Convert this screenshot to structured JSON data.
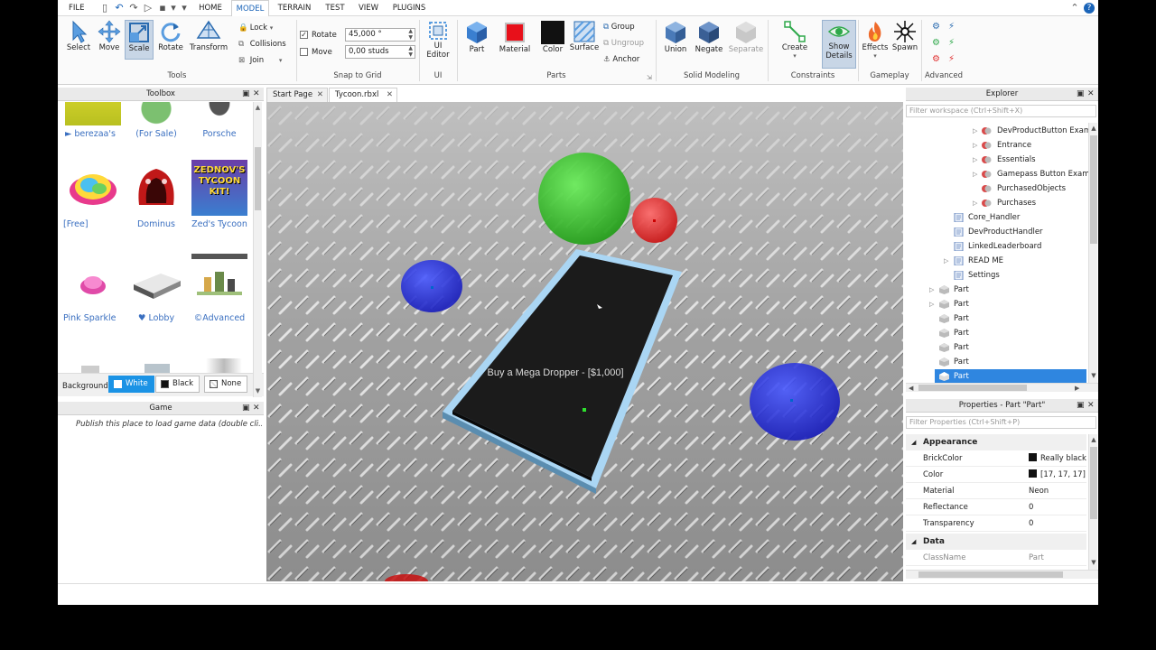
{
  "menubar": {
    "file": "FILE",
    "tabs": [
      "HOME",
      "MODEL",
      "TERRAIN",
      "TEST",
      "VIEW",
      "PLUGINS"
    ],
    "active_tab": "MODEL"
  },
  "ribbon": {
    "tools": {
      "buttons": [
        "Select",
        "Move",
        "Scale",
        "Rotate",
        "Transform"
      ],
      "active": "Scale",
      "lock": "Lock",
      "collisions": "Collisions",
      "join": "Join",
      "label": "Tools"
    },
    "snap": {
      "rotate_label": "Rotate",
      "rotate_value": "45,000 °",
      "move_label": "Move",
      "move_value": "0,00 studs",
      "label": "Snap to Grid"
    },
    "ui": {
      "button": "UI Editor",
      "label": "UI"
    },
    "parts": {
      "buttons": [
        "Part",
        "Material",
        "Color",
        "Surface"
      ],
      "group": "Group",
      "ungroup": "Ungroup",
      "anchor": "Anchor",
      "label": "Parts"
    },
    "solid": {
      "buttons": [
        "Union",
        "Negate",
        "Separate"
      ],
      "label": "Solid Modeling"
    },
    "constraints": {
      "create": "Create",
      "show_details": "Show Details",
      "label": "Constraints"
    },
    "gameplay": {
      "buttons": [
        "Effects",
        "Spawn"
      ],
      "label": "Gameplay"
    },
    "advanced": {
      "label": "Advanced"
    }
  },
  "toolbox": {
    "title": "Toolbox",
    "items": [
      {
        "label": "► berezaa's"
      },
      {
        "label": "(For Sale)"
      },
      {
        "label": "Porsche"
      },
      {
        "label": "[Free]"
      },
      {
        "label": "Dominus"
      },
      {
        "label": "Zed's Tycoon"
      },
      {
        "label": "Pink Sparkle"
      },
      {
        "label": "♥ Lobby"
      },
      {
        "label": "©Advanced"
      }
    ],
    "thumb_text": "ZEDNOV'S TYCOON KIT!",
    "background_label": "Background:",
    "bg_options": [
      "White",
      "Black",
      "None"
    ],
    "bg_active": "White"
  },
  "game_panel": {
    "title": "Game",
    "message": "Publish this place to load game data (double cli..."
  },
  "doc_tabs": [
    "Start Page",
    "Tycoon.rbxl"
  ],
  "viewport": {
    "billboard_text": "Buy a Mega Dropper - [$1,000]"
  },
  "explorer": {
    "title": "Explorer",
    "filter_placeholder": "Filter workspace (Ctrl+Shift+X)",
    "rows": [
      {
        "label": "DevProductButton Exam"
      },
      {
        "label": "Entrance"
      },
      {
        "label": "Essentials"
      },
      {
        "label": "Gamepass Button Examp"
      },
      {
        "label": "PurchasedObjects"
      },
      {
        "label": "Purchases"
      },
      {
        "label": "Core_Handler"
      },
      {
        "label": "DevProductHandler"
      },
      {
        "label": "LinkedLeaderboard"
      },
      {
        "label": "READ ME"
      },
      {
        "label": "Settings"
      },
      {
        "label": "Part"
      },
      {
        "label": "Part"
      },
      {
        "label": "Part"
      },
      {
        "label": "Part"
      },
      {
        "label": "Part"
      },
      {
        "label": "Part"
      },
      {
        "label": "Part"
      }
    ]
  },
  "properties": {
    "title": "Properties - Part \"Part\"",
    "filter_placeholder": "Filter Properties (Ctrl+Shift+P)",
    "appearance": "Appearance",
    "rows": [
      {
        "name": "BrickColor",
        "value": "Really black"
      },
      {
        "name": "Color",
        "value": "[17, 17, 17]"
      },
      {
        "name": "Material",
        "value": "Neon"
      },
      {
        "name": "Reflectance",
        "value": "0"
      },
      {
        "name": "Transparency",
        "value": "0"
      }
    ],
    "data": "Data",
    "classname": {
      "name": "ClassName",
      "value": "Part"
    }
  },
  "colors": {
    "accent": "#2f86e0",
    "selected_row": "#2f86e0",
    "link": "#3a6fc0"
  }
}
